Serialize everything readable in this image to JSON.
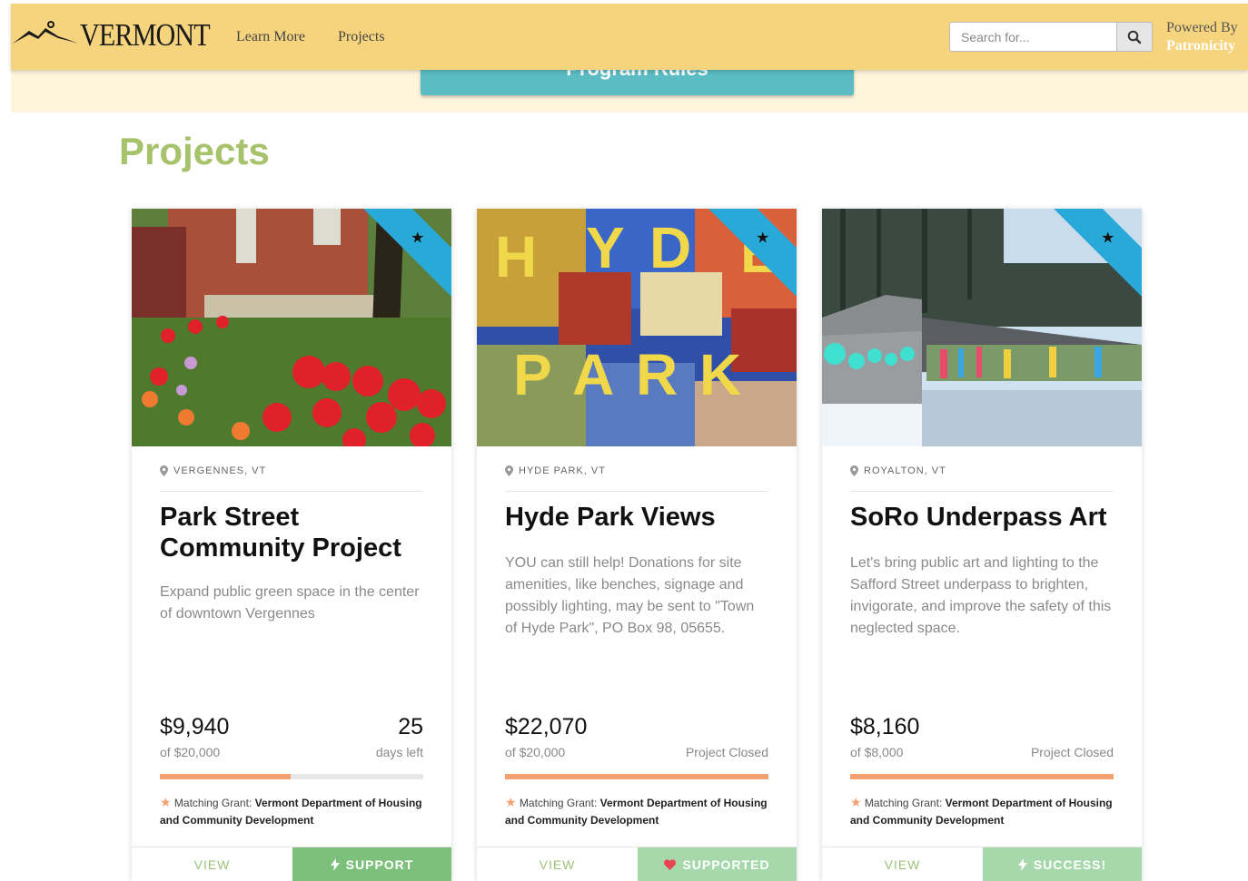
{
  "header": {
    "logo_text": "VERMONT",
    "nav": [
      {
        "label": "Learn More"
      },
      {
        "label": "Projects"
      }
    ],
    "search_placeholder": "Search for...",
    "powered_by": "Powered By",
    "powered_brand": "Patronicity"
  },
  "hero": {
    "button_label": "Program Rules"
  },
  "section_title": "Projects",
  "colors": {
    "header_bg": "#f6d47e",
    "accent_green": "#a6c26a",
    "button_green": "#7cc07c",
    "progress": "#f4a070",
    "ribbon": "#29a9d8"
  },
  "cards": [
    {
      "location": "VERGENNES, VT",
      "title": "Park Street Community Project",
      "description": "Expand public green space in the center of downtown Vergennes",
      "amount": "$9,940",
      "goal": "of $20,000",
      "right_big": "25",
      "right_small": "days left",
      "progress_fraction": 0.497,
      "grant_label": "Matching Grant:",
      "grant_org": "Vermont Department of Housing and Community Development",
      "view_label": "VIEW",
      "action_label": "SUPPORT",
      "action_icon": "bolt-icon"
    },
    {
      "location": "HYDE PARK, VT",
      "title": "Hyde Park Views",
      "description": "YOU can still help! Donations for site amenities, like benches, signage and possibly lighting, may be sent to \"Town of Hyde Park\", PO Box 98, 05655.",
      "amount": "$22,070",
      "goal": "of $20,000",
      "right_big": "",
      "right_small": "Project Closed",
      "progress_fraction": 1.0,
      "grant_label": "Matching Grant:",
      "grant_org": "Vermont Department of Housing and Community Development",
      "view_label": "VIEW",
      "action_label": "SUPPORTED",
      "action_icon": "heart-icon"
    },
    {
      "location": "ROYALTON, VT",
      "title": "SoRo Underpass Art",
      "description": "Let's bring public art and lighting to the Safford Street underpass to brighten, invigorate, and improve the safety of this neglected space.",
      "amount": "$8,160",
      "goal": "of $8,000",
      "right_big": "",
      "right_small": "Project Closed",
      "progress_fraction": 1.0,
      "grant_label": "Matching Grant:",
      "grant_org": "Vermont Department of Housing and Community Development",
      "view_label": "VIEW",
      "action_label": "SUCCESS!",
      "action_icon": "bolt-icon"
    }
  ]
}
